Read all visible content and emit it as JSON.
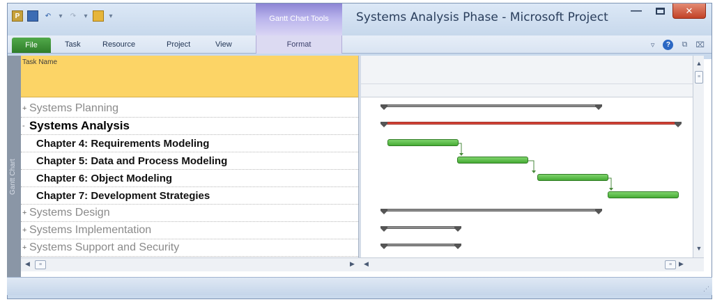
{
  "window": {
    "title": "Systems Analysis Phase - Microsoft Project",
    "contextual_group": "Gantt Chart Tools",
    "controls": {
      "minimize": "—",
      "close": "✕"
    }
  },
  "ribbon": {
    "tabs": [
      "File",
      "Task",
      "Resource",
      "Project",
      "View"
    ],
    "contextual_tab": "Format"
  },
  "view_sidebar": {
    "label": "Gantt Chart"
  },
  "table": {
    "column_header": "Task Name",
    "rows": [
      {
        "name": "Systems Planning",
        "type": "summary",
        "expander": "+"
      },
      {
        "name": "Systems Analysis",
        "type": "summary-active",
        "expander": "-"
      },
      {
        "name": "Chapter 4: Requirements Modeling",
        "type": "task"
      },
      {
        "name": "Chapter 5: Data and Process Modeling",
        "type": "task"
      },
      {
        "name": "Chapter 6: Object Modeling",
        "type": "task"
      },
      {
        "name": "Chapter 7: Development Strategies",
        "type": "task"
      },
      {
        "name": "Systems Design",
        "type": "summary",
        "expander": "+"
      },
      {
        "name": "Systems Implementation",
        "type": "summary",
        "expander": "+"
      },
      {
        "name": "Systems Support and Security",
        "type": "summary",
        "expander": "+"
      }
    ]
  },
  "gantt": {
    "colors": {
      "summary": "#8c8c8c",
      "critical_summary": "#d9463a",
      "task": "#46ab34",
      "header": "#fcd466"
    }
  }
}
